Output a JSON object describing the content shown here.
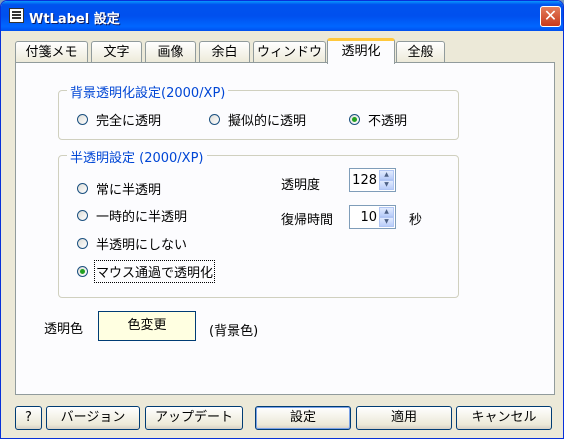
{
  "window": {
    "title": "WtLabel 設定"
  },
  "tabs": [
    "付箋メモ",
    "文字",
    "画像",
    "余白",
    "ウィンドウ",
    "透明化",
    "全般"
  ],
  "group_bg": {
    "title": "背景透明化設定(2000/XP)",
    "options": [
      "完全に透明",
      "擬似的に透明",
      "不透明"
    ],
    "selected": "不透明"
  },
  "group_semi": {
    "title": "半透明設定 (2000/XP)",
    "options": [
      "常に半透明",
      "一時的に半透明",
      "半透明にしない",
      "マウス通過で透明化"
    ],
    "selected": "マウス通過で透明化",
    "opacity_label": "透明度",
    "opacity_value": "128",
    "restore_label": "復帰時間",
    "restore_value": "10",
    "restore_unit": "秒"
  },
  "transparent_color": {
    "label": "透明色",
    "button": "色変更",
    "note": "(背景色)",
    "swatch": "#ffffe1"
  },
  "buttons": {
    "help": "?",
    "version": "バージョン",
    "update": "アップデート",
    "ok": "設定",
    "apply": "適用",
    "cancel": "キャンセル"
  }
}
